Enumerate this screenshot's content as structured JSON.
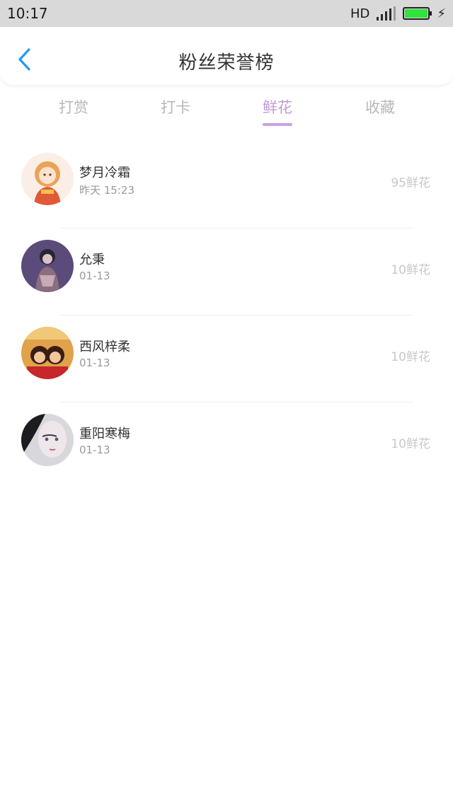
{
  "status_bar": {
    "time": "10:17",
    "hd": "HD",
    "battery_color": "#2fe33a"
  },
  "header": {
    "title": "粉丝荣誉榜",
    "back_icon": "chevron-left-icon",
    "back_color": "#1e9bf0"
  },
  "tabs": [
    {
      "label": "打赏",
      "active": false
    },
    {
      "label": "打卡",
      "active": false
    },
    {
      "label": "鲜花",
      "active": true
    },
    {
      "label": "收藏",
      "active": false
    }
  ],
  "accent_color": "#c19ad8",
  "list": [
    {
      "name": "梦月冷霜",
      "time": "昨天 15:23",
      "amount": "95鲜花"
    },
    {
      "name": "允秉",
      "time": "01-13",
      "amount": "10鲜花"
    },
    {
      "name": "西风梓柔",
      "time": "01-13",
      "amount": "10鲜花"
    },
    {
      "name": "重阳寒梅",
      "time": "01-13",
      "amount": "10鲜花"
    }
  ]
}
